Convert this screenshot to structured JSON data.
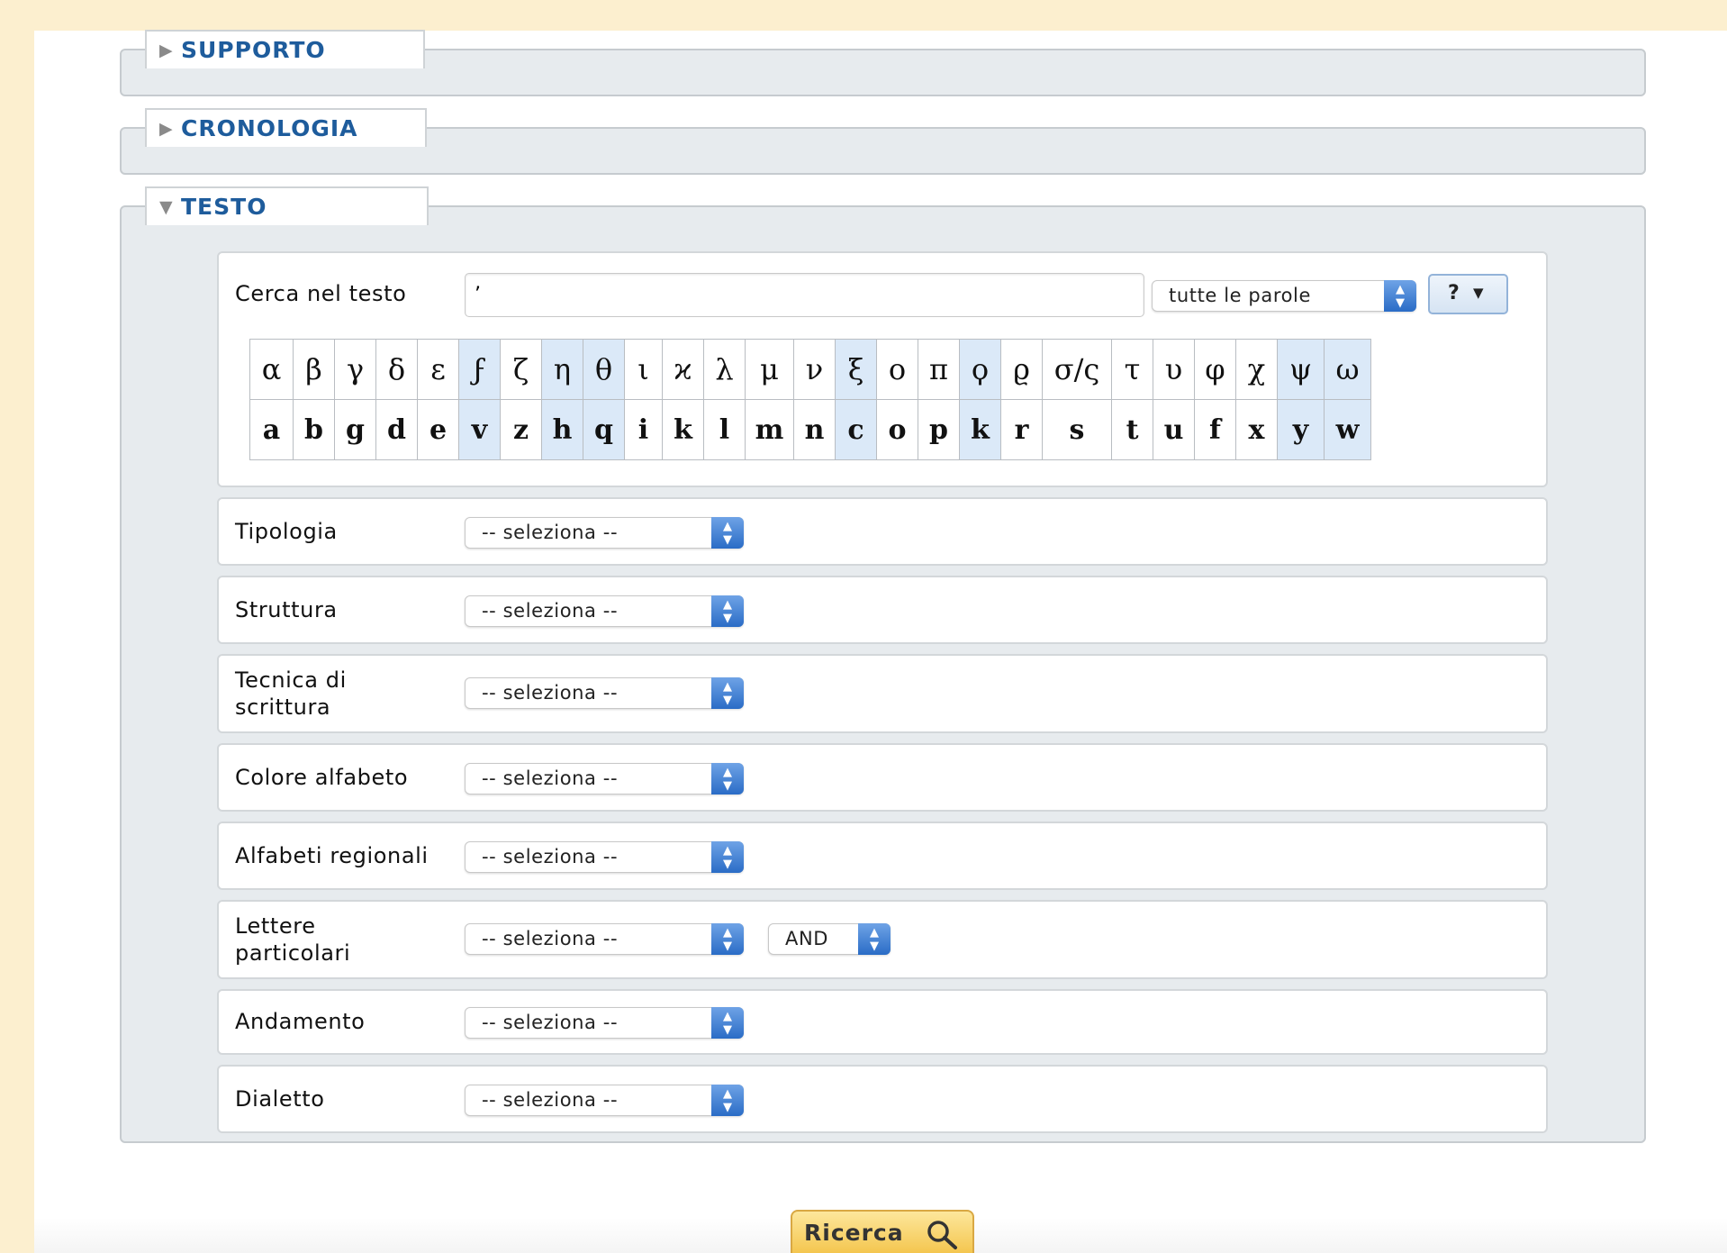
{
  "sections": [
    {
      "key": "supporto",
      "label": "SUPPORTO",
      "toggle": "▶"
    },
    {
      "key": "cronologia",
      "label": "CRONOLOGIA",
      "toggle": "▶"
    },
    {
      "key": "testo",
      "label": "TESTO",
      "toggle": "▼"
    }
  ],
  "search": {
    "label": "Cerca nel testo",
    "value": "’",
    "mode": "tutte le parole",
    "help": "?",
    "greek": [
      "α",
      "β",
      "γ",
      "δ",
      "ε",
      "ϝ",
      "ζ",
      "η",
      "θ",
      "ι",
      "ϰ",
      "λ",
      "μ",
      "ν",
      "ξ",
      "ο",
      "π",
      "ϙ",
      "ϱ",
      "σ/ς",
      "τ",
      "υ",
      "φ",
      "χ",
      "ψ",
      "ω"
    ],
    "latin": [
      "a",
      "b",
      "g",
      "d",
      "e",
      "v",
      "z",
      "h",
      "q",
      "i",
      "k",
      "l",
      "m",
      "n",
      "c",
      "o",
      "p",
      "k",
      "r",
      "s",
      "t",
      "u",
      "f",
      "x",
      "y",
      "w"
    ]
  },
  "filters": [
    {
      "label": "Tipologia",
      "value": "-- seleziona --"
    },
    {
      "label": "Struttura",
      "value": "-- seleziona --"
    },
    {
      "label": "Tecnica di\nscrittura",
      "value": "-- seleziona --"
    },
    {
      "label": "Colore alfabeto",
      "value": "-- seleziona --"
    },
    {
      "label": "Alfabeti regionali",
      "value": "-- seleziona --"
    },
    {
      "label": "Lettere\nparticolari",
      "value": "-- seleziona --",
      "operator": "AND"
    },
    {
      "label": "Andamento",
      "value": "-- seleziona --"
    },
    {
      "label": "Dialetto",
      "value": "-- seleziona --"
    }
  ],
  "submit": {
    "label": "Ricerca"
  },
  "colors": {
    "background": "#fcefcf",
    "fieldset": "#e7ebee",
    "legend_text": "#1e5c9c",
    "highlight_key": "#dbe9f8",
    "button": "#f4c64f"
  }
}
